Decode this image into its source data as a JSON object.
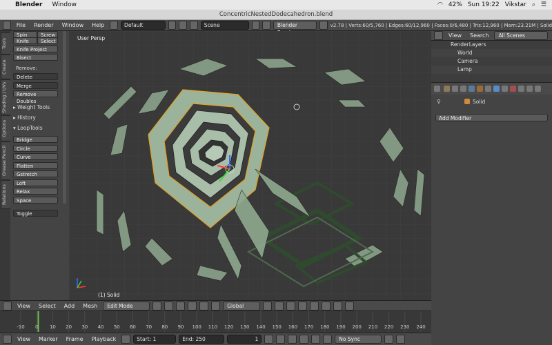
{
  "mac": {
    "app_name": "Blender",
    "menu_window": "Window",
    "battery": "42%",
    "clock": "Sun 19:22",
    "user": "Vikstar"
  },
  "window_title": "ConcentricNestedDodecahedron.blend",
  "header": {
    "menus": [
      "File",
      "Render",
      "Window",
      "Help"
    ],
    "layout": "Default",
    "scene": "Scene",
    "engine": "Blender Render",
    "stats": "v2.78 | Verts:60/5,760 | Edges:60/12,960 | Faces:0/6,480 | Tris:12,960 | Mem:23.21M | Solid"
  },
  "tabs": [
    "Tools",
    "Create",
    "Shading / UVs",
    "Options",
    "Grease Pencil",
    "Relations"
  ],
  "tool_panel": {
    "top_buttons": [
      [
        "Spin",
        "Screw"
      ],
      [
        "Knife",
        "Select"
      ]
    ],
    "knife_project": "Knife Project",
    "bisect": "Bisect",
    "remove_label": "Remove:",
    "delete": "Delete",
    "merge": "Merge",
    "remove_doubles": "Remove Doubles",
    "weight_tools": "Weight Tools",
    "history": "History",
    "looptools": "LoopTools",
    "loop_items": [
      "Bridge",
      "Circle",
      "Curve",
      "Flatten",
      "Gstretch",
      "Loft",
      "Relax",
      "Space"
    ],
    "toggle": "Toggle"
  },
  "viewport": {
    "view_label": "User Persp",
    "object_label": "(1) Solid"
  },
  "vp_header": {
    "menus": [
      "View",
      "Select",
      "Add",
      "Mesh"
    ],
    "mode": "Edit Mode",
    "orientation": "Global"
  },
  "timeline": {
    "ticks": [
      "-10",
      "0",
      "10",
      "20",
      "30",
      "40",
      "50",
      "60",
      "70",
      "80",
      "90",
      "100",
      "110",
      "120",
      "130",
      "140",
      "150",
      "160",
      "170",
      "180",
      "190",
      "200",
      "210",
      "220",
      "230",
      "240"
    ],
    "current_frame": 1,
    "menus": [
      "View",
      "Marker",
      "Frame",
      "Playback"
    ],
    "start_label": "Start:",
    "start": "1",
    "end_label": "End:",
    "end": "250",
    "current": "1",
    "sync": "No Sync"
  },
  "outliner": {
    "view": "View",
    "search": "Search",
    "scenes": "All Scenes",
    "rows": [
      "RenderLayers",
      "World",
      "Camera",
      "Lamp"
    ]
  },
  "properties": {
    "object_name": "Solid",
    "add_modifier": "Add Modifier"
  },
  "colors": {
    "mesh_green": "#8fa98f",
    "mesh_dark": "#2f4a2f",
    "selected_edge": "#e8a321",
    "grid": "#404040"
  }
}
